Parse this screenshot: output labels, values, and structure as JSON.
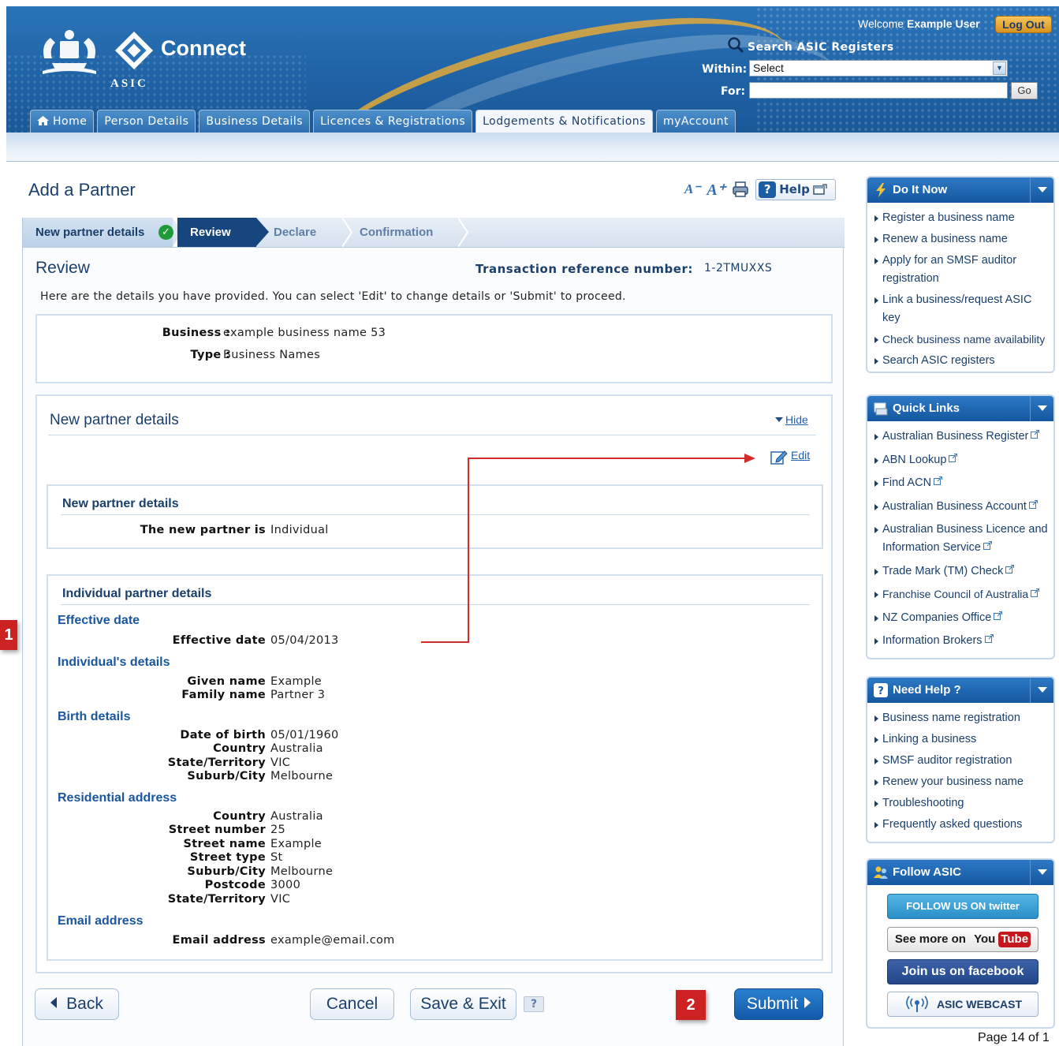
{
  "header": {
    "brand": "Connect",
    "agency": "ASIC",
    "welcome_prefix": "Welcome",
    "user_name": "Example User",
    "logout_label": "Log Out",
    "search_title": "Search ASIC Registers",
    "within_label": "Within:",
    "within_value": "Select",
    "for_label": "For:",
    "for_value": "",
    "go_label": "Go"
  },
  "nav": {
    "tabs": [
      {
        "label": "Home"
      },
      {
        "label": "Person Details"
      },
      {
        "label": "Business Details"
      },
      {
        "label": "Licences & Registrations"
      },
      {
        "label": "Lodgements & Notifications",
        "active": true
      },
      {
        "label": "myAccount"
      }
    ]
  },
  "page": {
    "title": "Add a Partner",
    "help_label": "Help"
  },
  "steps": [
    "New partner details",
    "Review",
    "Declare",
    "Confirmation"
  ],
  "review": {
    "heading": "Review",
    "txn_label": "Transaction reference number:",
    "txn_value": "1-2TMUXXS",
    "intro": "Here are the details you have provided. You can select 'Edit' to change details or 'Submit' to proceed.",
    "business_label": "Business :",
    "business_value": "example business name 53",
    "type_label": "Type :",
    "type_value": "Business Names"
  },
  "partner": {
    "section_title": "New partner details",
    "hide_label": "Hide",
    "edit_label": "Edit",
    "box1_title": "New partner details",
    "new_partner_label": "The new partner is",
    "new_partner_value": "Individual",
    "box2_title": "Individual partner details",
    "effective_h": "Effective date",
    "effective_label": "Effective date",
    "effective_value": "05/04/2013",
    "individual_h": "Individual's details",
    "given_label": "Given name",
    "given_value": "Example",
    "family_label": "Family name",
    "family_value": "Partner 3",
    "birth_h": "Birth details",
    "dob_label": "Date of birth",
    "dob_value": "05/01/1960",
    "birth_country_label": "Country",
    "birth_country_value": "Australia",
    "birth_state_label": "State/Territory",
    "birth_state_value": "VIC",
    "birth_suburb_label": "Suburb/City",
    "birth_suburb_value": "Melbourne",
    "res_h": "Residential address",
    "res_country_label": "Country",
    "res_country_value": "Australia",
    "street_no_label": "Street number",
    "street_no_value": "25",
    "street_name_label": "Street name",
    "street_name_value": "Example",
    "street_type_label": "Street type",
    "street_type_value": "St",
    "res_suburb_label": "Suburb/City",
    "res_suburb_value": "Melbourne",
    "postcode_label": "Postcode",
    "postcode_value": "3000",
    "res_state_label": "State/Territory",
    "res_state_value": "VIC",
    "email_h": "Email address",
    "email_label": "Email address",
    "email_value": "example@email.com"
  },
  "buttons": {
    "back": "Back",
    "cancel": "Cancel",
    "save_exit": "Save & Exit",
    "help_q": "?",
    "submit": "Submit"
  },
  "markers": {
    "one": "1",
    "two": "2"
  },
  "sidebar": {
    "do_it_now": {
      "title": "Do It Now",
      "items": [
        "Register a business name",
        "Renew a business name",
        "Apply for an SMSF auditor registration",
        "Link a business/request ASIC key",
        "Check business name availability",
        "Search ASIC registers"
      ]
    },
    "quick_links": {
      "title": "Quick Links",
      "items": [
        "Australian Business Register",
        "ABN Lookup",
        "Find ACN",
        "Australian Business Account",
        "Australian Business Licence and Information Service",
        "Trade Mark (TM) Check",
        "Franchise Council of Australia",
        "NZ Companies Office",
        "Information Brokers"
      ]
    },
    "need_help": {
      "title": "Need Help ?",
      "items": [
        "Business name registration",
        "Linking a business",
        "SMSF auditor registration",
        "Renew your business name",
        "Troubleshooting",
        "Frequently asked questions"
      ]
    },
    "follow": {
      "title": "Follow ASIC",
      "twitter": "FOLLOW US ON twitter",
      "youtube_prefix": "See more on",
      "youtube_you": "You",
      "youtube_tube": "Tube",
      "facebook": "Join us on facebook",
      "webcast": "ASIC WEBCAST"
    }
  },
  "footer": {
    "page_label": "Page 14 of 1"
  },
  "colors": {
    "brand_blue": "#1f63a6",
    "accent_gold": "#e2a93a",
    "marker_red": "#cc2222",
    "submit_blue": "#135aa8"
  }
}
